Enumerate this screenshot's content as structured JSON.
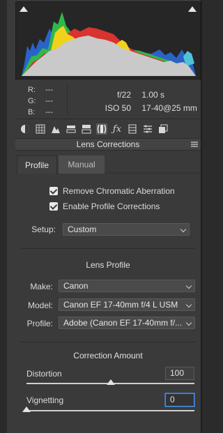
{
  "histogram": {
    "clip_shadow_icon": "shadow-clipping-icon",
    "clip_highlight_icon": "highlight-clipping-icon"
  },
  "info": {
    "r_label": "R:",
    "r_value": "---",
    "g_label": "G:",
    "g_value": "---",
    "b_label": "B:",
    "b_value": "---",
    "aperture": "f/22",
    "shutter": "1.00 s",
    "iso": "ISO 50",
    "lens": "17-40@25 mm"
  },
  "toolbar": {
    "icons": [
      "basic-icon",
      "tone-curve-icon",
      "detail-icon",
      "hsl-icon",
      "split-toning-icon",
      "lens-corrections-icon",
      "fx-icon",
      "camera-calibration-icon",
      "presets-icon",
      "snapshots-icon"
    ]
  },
  "panel": {
    "title": "Lens Corrections"
  },
  "tabs": {
    "profile": "Profile",
    "manual": "Manual"
  },
  "options": {
    "remove_ca": "Remove Chromatic Aberration",
    "enable_profile": "Enable Profile Corrections"
  },
  "setup": {
    "label": "Setup:",
    "value": "Custom"
  },
  "lens_profile": {
    "heading": "Lens Profile",
    "make_label": "Make:",
    "make_value": "Canon",
    "model_label": "Model:",
    "model_value": "Canon EF 17-40mm f/4 L USM",
    "profile_label": "Profile:",
    "profile_value": "Adobe (Canon EF 17-40mm f/..."
  },
  "correction": {
    "heading": "Correction Amount",
    "distortion_label": "Distortion",
    "distortion_value": "100",
    "distortion_level": 100,
    "vignetting_label": "Vignetting",
    "vignetting_value": "0",
    "vignetting_level": 0
  },
  "colors": {
    "panel_bg": "#3a3a3a",
    "focus_ring": "#4f8fd6"
  }
}
